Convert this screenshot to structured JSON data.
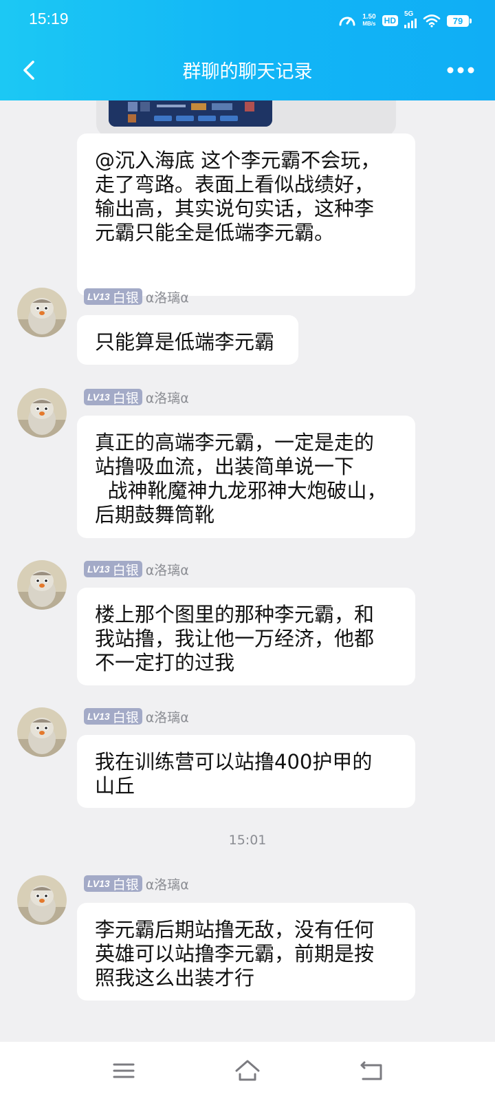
{
  "status_bar": {
    "time": "15:19",
    "net_speed_value": "1.50",
    "net_speed_unit": "MB/s",
    "hd": "HD",
    "network": "5G",
    "battery": "79"
  },
  "header": {
    "title": "群聊的聊天记录"
  },
  "messages": [
    {
      "text": "@沉入海底 这个李元霸不会玩，\n走了弯路。表面上看似战绩好，\n输出高，其实说句实话，这种李\n元霸只能全是低端李元霸。"
    },
    {
      "level": "LV13",
      "rank": "白银",
      "sender": "α洛璃α",
      "text": "只能算是低端李元霸"
    },
    {
      "level": "LV13",
      "rank": "白银",
      "sender": "α洛璃α",
      "text": "真正的高端李元霸，一定是走的\n站撸吸血流，出装简单说一下\n  战神靴魔神九龙邪神大炮破山，\n后期鼓舞筒靴"
    },
    {
      "level": "LV13",
      "rank": "白银",
      "sender": "α洛璃α",
      "text": "楼上那个图里的那种李元霸，和\n我站撸，我让他一万经济，他都\n不一定打的过我"
    },
    {
      "level": "LV13",
      "rank": "白银",
      "sender": "α洛璃α",
      "text": "我在训练营可以站撸400护甲的\n山丘"
    },
    {
      "level": "LV13",
      "rank": "白银",
      "sender": "α洛璃α",
      "text": "李元霸后期站撸无敌，没有任何\n英雄可以站撸李元霸，前期是按\n照我这么出装才行"
    }
  ],
  "timestamp_divider": "15:01",
  "colors": {
    "header_bg": "#12b6f6",
    "chat_bg": "#f0f0f2",
    "badge_bg": "#a3aac7"
  },
  "icons": {
    "back": "chevron-left-icon",
    "more": "more-dots-icon",
    "menu": "menu-lines-icon",
    "home": "home-icon",
    "recent": "back-return-icon"
  }
}
